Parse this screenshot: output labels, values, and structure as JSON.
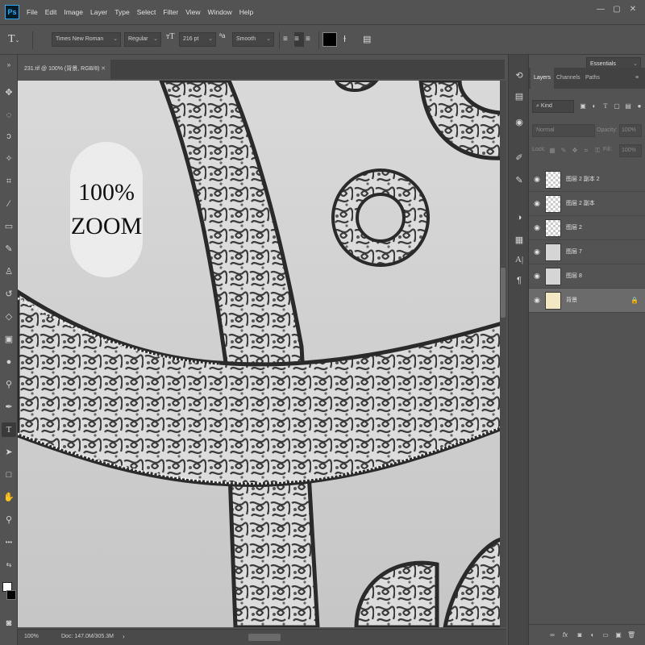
{
  "app": {
    "logo": "Ps"
  },
  "menu": [
    "File",
    "Edit",
    "Image",
    "Layer",
    "Type",
    "Select",
    "Filter",
    "View",
    "Window",
    "Help"
  ],
  "window_controls": [
    "—",
    "▢",
    "✕"
  ],
  "options": {
    "tool_icon": "type-tool-icon",
    "font_family": "Times New Roman",
    "font_style": "Regular",
    "font_size": "216 pt",
    "antialias": "Smooth",
    "color_swatch": "#000000"
  },
  "workspace": "Essentials",
  "document": {
    "tab_title": "231.tif @ 100% (背景, RGB/8)",
    "canvas_text": [
      "100%",
      "ZOOM"
    ]
  },
  "status": {
    "zoom": "100%",
    "doc": "Doc: 147.0M/305.3M"
  },
  "panel": {
    "tabs": [
      "Layers",
      "Channels",
      "Paths"
    ],
    "filter_label": "Kind",
    "blend_mode": "Normal",
    "opacity_label": "Opacity:",
    "opacity_value": "100%",
    "lock_label": "Lock:",
    "fill_label": "Fill:",
    "fill_value": "100%",
    "layers": [
      {
        "name": "图层 2 副本 2",
        "thumb": "transparent",
        "selected": false,
        "locked": false
      },
      {
        "name": "图层 2 副本",
        "thumb": "transparent",
        "selected": false,
        "locked": false
      },
      {
        "name": "图层 2",
        "thumb": "transparent",
        "selected": false,
        "locked": false
      },
      {
        "name": "图层 7",
        "thumb": "image",
        "selected": false,
        "locked": false
      },
      {
        "name": "图层 8",
        "thumb": "image",
        "selected": false,
        "locked": false
      },
      {
        "name": "背景",
        "thumb": "background",
        "selected": true,
        "locked": true
      }
    ]
  }
}
